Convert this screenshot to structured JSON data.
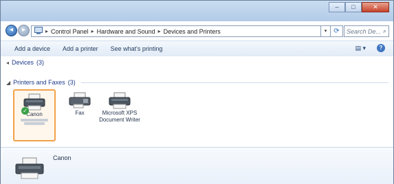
{
  "window": {
    "caption_buttons": {
      "minimize": "–",
      "maximize": "□",
      "close": "✕"
    }
  },
  "address": {
    "root_icon": "control-panel-icon",
    "crumbs": [
      "Control Panel",
      "Hardware and Sound",
      "Devices and Printers"
    ],
    "separator": "▸",
    "dropdown": "▾",
    "refresh": "⟳",
    "search_placeholder": "Search De...",
    "search_icon": "⌕"
  },
  "command_bar": {
    "commands": [
      "Add a device",
      "Add a printer",
      "See what's printing"
    ],
    "view_options": "▤ ▾",
    "help": "?"
  },
  "groups": {
    "devices": {
      "collapse": "◂",
      "label": "Devices",
      "count": "(3)"
    },
    "printers": {
      "collapse": "◢",
      "label": "Printers and Faxes",
      "count": "(3)"
    }
  },
  "printers": [
    {
      "name": "Canon",
      "model_hidden": true,
      "default": true,
      "default_mark": "✓"
    },
    {
      "name": "Fax",
      "model_hidden": false,
      "default": false
    },
    {
      "name": "Microsoft XPS",
      "sub": "Document Writer",
      "default": false
    }
  ],
  "details": {
    "name": "Canon"
  },
  "colors": {
    "accent": "#2a5fa6",
    "selection_border": "#f2a14a",
    "group_heading": "#1e3a8a"
  }
}
